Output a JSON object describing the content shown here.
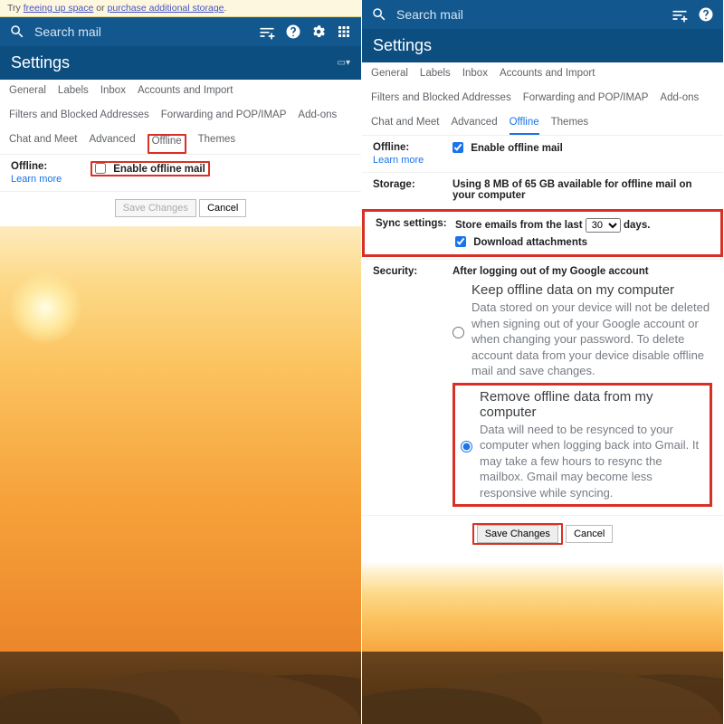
{
  "banner": {
    "prefix": "Try ",
    "link1": "freeing up space",
    "mid": " or ",
    "link2": "purchase additional storage",
    "suffix": "."
  },
  "search_placeholder": "Search mail",
  "settings_title": "Settings",
  "tabs1": [
    "General",
    "Labels",
    "Inbox",
    "Accounts and Import",
    "Filters and Blocked Addresses"
  ],
  "tabs2": [
    "Forwarding and POP/IMAP",
    "Add-ons",
    "Chat and Meet",
    "Advanced",
    "Offline",
    "Themes"
  ],
  "left": {
    "offline_label": "Offline:",
    "learn": "Learn more",
    "enable": "Enable offline mail",
    "save": "Save Changes",
    "cancel": "Cancel"
  },
  "right": {
    "offline_label": "Offline:",
    "learn": "Learn more",
    "enable": "Enable offline mail",
    "storage_label": "Storage:",
    "storage_val": "Using 8 MB of 65 GB available for offline mail on your computer",
    "sync_label": "Sync settings:",
    "sync_pre": "Store emails from the last ",
    "sync_days": "30",
    "sync_post": " days.",
    "dl": "Download attachments",
    "sec_label": "Security:",
    "sec_head": "After logging out of my Google account",
    "opt1_t": "Keep offline data on my computer",
    "opt1_d": "Data stored on your device will not be deleted when signing out of your Google account or when changing your password. To delete account data from your device disable offline mail and save changes.",
    "opt2_t": "Remove offline data from my computer",
    "opt2_d": "Data will need to be resynced to your computer when logging back into Gmail. It may take a few hours to resync the mailbox. Gmail may become less responsive while syncing.",
    "save": "Save Changes",
    "cancel": "Cancel"
  }
}
